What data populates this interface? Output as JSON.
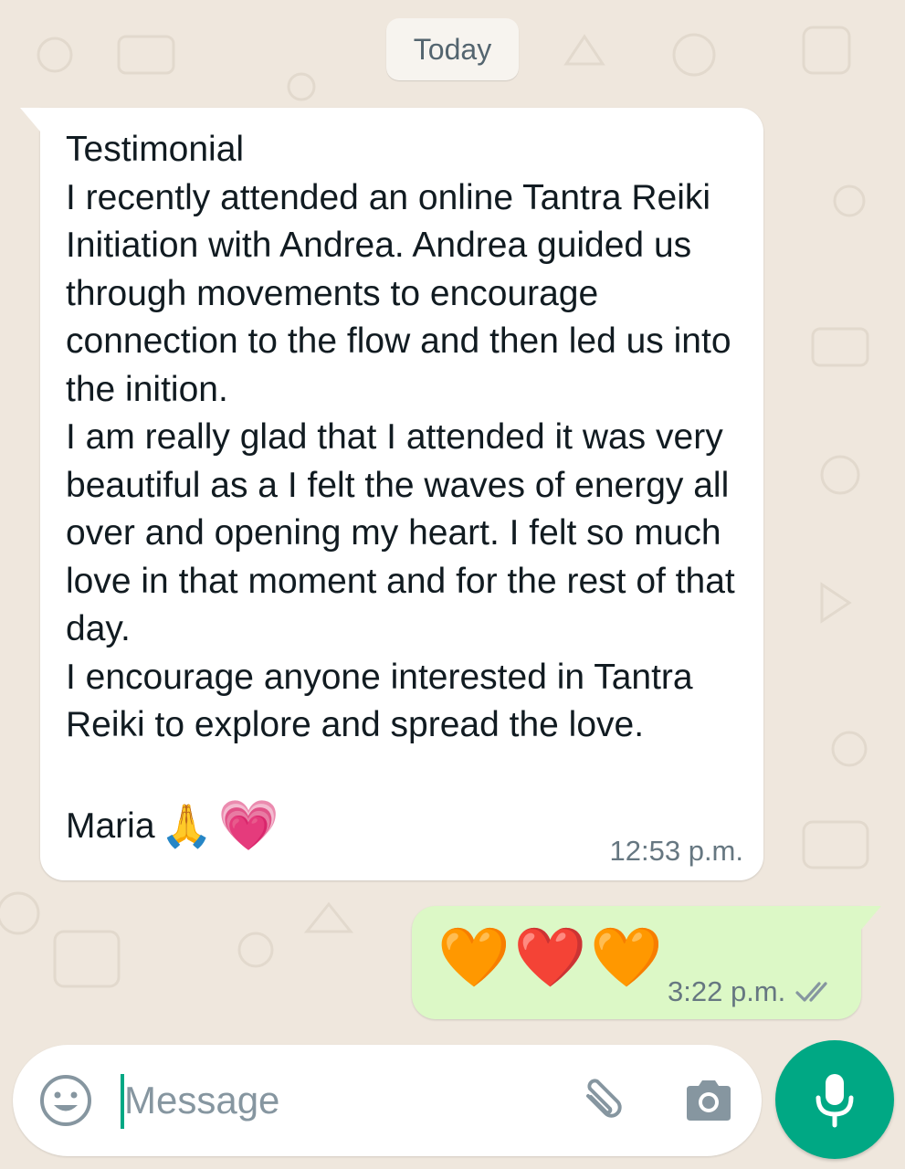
{
  "date_chip": "Today",
  "incoming_message": {
    "text": "Testimonial\nI recently attended an online Tantra Reiki Initiation with Andrea. Andrea guided us through movements to encourage connection to the flow and then led us into the inition.\nI am really glad that I attended it was very beautiful as a I felt the waves of energy all over and opening my heart. I felt so much love in that moment and for the rest of that day.\nI encourage anyone interested in Tantra Reiki to explore and spread the love.",
    "signature": "Maria",
    "signature_emojis": [
      "🙏",
      "💗"
    ],
    "time": "12:53 p.m."
  },
  "outgoing_message": {
    "emojis": [
      "🧡",
      "❤️",
      "🧡"
    ],
    "time": "3:22 p.m.",
    "status": "read"
  },
  "composer": {
    "placeholder": "Message"
  },
  "colors": {
    "background": "#efe7dd",
    "incoming_bubble": "#ffffff",
    "outgoing_bubble": "#dcf8c6",
    "accent": "#00a884",
    "timestamp": "#667781",
    "icon": "#8696a0"
  },
  "icons": [
    "smiley-icon",
    "paperclip-icon",
    "camera-icon",
    "mic-icon",
    "double-check-icon"
  ]
}
